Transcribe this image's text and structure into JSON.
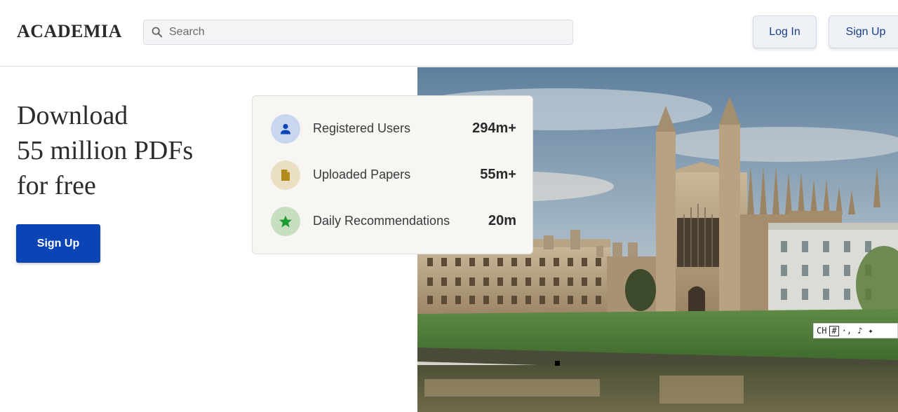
{
  "header": {
    "logo": "ACADEMIA",
    "search_placeholder": "Search",
    "login_label": "Log In",
    "signup_label": "Sign Up"
  },
  "hero": {
    "headline_lines": [
      "Download",
      "55 million PDFs",
      "for free"
    ],
    "cta_label": "Sign Up"
  },
  "stats": [
    {
      "label": "Registered Users",
      "value": "294m+",
      "icon": "user-icon",
      "color": "#c8d6ef",
      "icon_color": "#0b45b5"
    },
    {
      "label": "Uploaded Papers",
      "value": "55m+",
      "icon": "document-icon",
      "color": "#ebdfc3",
      "icon_color": "#b58a1d"
    },
    {
      "label": "Daily Recommendations",
      "value": "20m",
      "icon": "star-icon",
      "color": "#c6dfc0",
      "icon_color": "#1e9b2e"
    }
  ],
  "ime": {
    "mode": "CH"
  },
  "colors": {
    "primary": "#0b45b5",
    "link": "#1a3f87"
  }
}
